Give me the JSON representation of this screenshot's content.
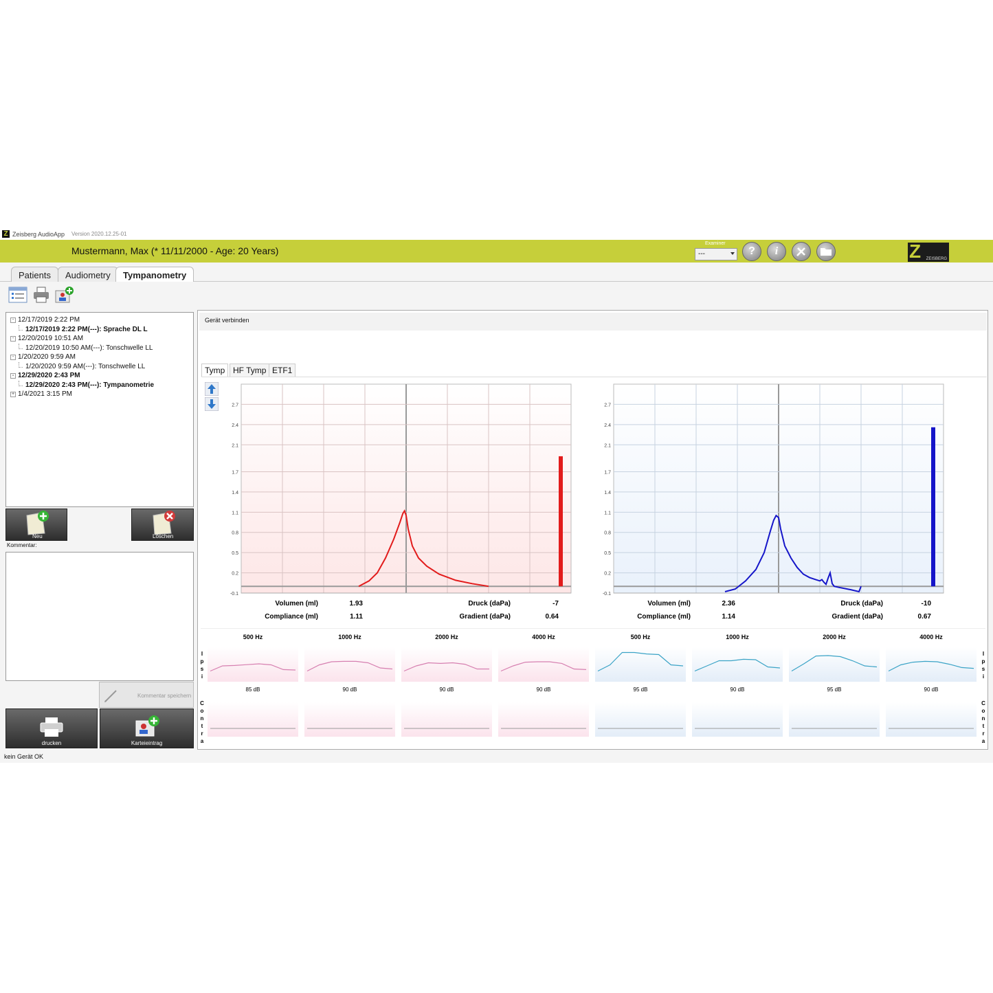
{
  "app": {
    "title": "Zeisberg AudioApp",
    "version": "Version 2020.12.25-01",
    "patient": "Mustermann, Max (* 11/11/2000 - Age: 20 Years)",
    "examiner_label": "Examiner",
    "examiner_value": "---",
    "brand": "ZEISBERG",
    "colors": {
      "accent": "#c6cf3a",
      "right_ear": "#e21b1b",
      "left_ear": "#1515c9"
    }
  },
  "tabs": [
    {
      "label": "Patients"
    },
    {
      "label": "Audiometry"
    },
    {
      "label": "Tympanometry"
    }
  ],
  "toolbar": {
    "icons": [
      "list-view-icon",
      "print-icon",
      "add-record-icon"
    ]
  },
  "tree": [
    {
      "label": "12/17/2019 2:22 PM",
      "expand": "-",
      "child": false,
      "bold": false
    },
    {
      "label": "12/17/2019 2:22 PM(---): Sprache DL L",
      "child": true,
      "bold": true
    },
    {
      "label": "12/20/2019 10:51 AM",
      "expand": "-",
      "child": false,
      "bold": false
    },
    {
      "label": "12/20/2019 10:50 AM(---): Tonschwelle LL",
      "child": true,
      "bold": false
    },
    {
      "label": "1/20/2020 9:59 AM",
      "expand": "-",
      "child": false,
      "bold": false
    },
    {
      "label": "1/20/2020 9:59 AM(---): Tonschwelle LL",
      "child": true,
      "bold": false
    },
    {
      "label": "12/29/2020 2:43 PM",
      "expand": "-",
      "child": false,
      "bold": true
    },
    {
      "label": "12/29/2020 2:43 PM(---): Tympanometrie",
      "child": true,
      "bold": true
    },
    {
      "label": "1/4/2021 3:15 PM",
      "expand": "+",
      "child": false,
      "bold": false
    }
  ],
  "buttons": {
    "new": "Neu",
    "delete": "Löschen",
    "comment_label": "Kommentar:",
    "save_comment": "Kommentar speichern",
    "print": "drucken",
    "record": "Karteieintrag"
  },
  "connect": "Gerät verbinden",
  "subtabs": [
    {
      "label": "Tymp"
    },
    {
      "label": "HF Tymp"
    },
    {
      "label": "ETF1"
    }
  ],
  "status": "kein Gerät  OK",
  "chart_data": [
    {
      "type": "line",
      "ear": "right",
      "color": "#e21b1b",
      "ylim": [
        -0.1,
        3.0
      ],
      "xlim": [
        -400,
        400
      ],
      "yticks": [
        "-0.1",
        "0.2",
        "0.5",
        "0.8",
        "1.1",
        "1.4",
        "1.7",
        "2.1",
        "2.4",
        "2.7"
      ],
      "x": [
        -115,
        -90,
        -70,
        -50,
        -30,
        -15,
        -8,
        -4,
        0,
        5,
        15,
        30,
        50,
        80,
        120,
        160,
        200
      ],
      "y": [
        0.0,
        0.08,
        0.2,
        0.42,
        0.7,
        0.95,
        1.08,
        1.12,
        1.05,
        0.85,
        0.6,
        0.42,
        0.3,
        0.18,
        0.09,
        0.04,
        0.0
      ],
      "volume_bar": 1.93,
      "stats": [
        {
          "label": "Volumen (ml)",
          "value": "1.93"
        },
        {
          "label": "Compliance (ml)",
          "value": "1.11"
        },
        {
          "label": "Druck (daPa)",
          "value": "-7"
        },
        {
          "label": "Gradient (daPa)",
          "value": "0.64"
        }
      ]
    },
    {
      "type": "line",
      "ear": "left",
      "color": "#1515c9",
      "ylim": [
        -0.1,
        3.0
      ],
      "xlim": [
        -400,
        400
      ],
      "yticks": [
        "-0.1",
        "0.2",
        "0.5",
        "0.8",
        "1.1",
        "1.4",
        "1.7",
        "2.1",
        "2.4",
        "2.7"
      ],
      "x": [
        -130,
        -105,
        -80,
        -55,
        -35,
        -20,
        -12,
        -6,
        0,
        5,
        15,
        30,
        45,
        60,
        75,
        90,
        100,
        105,
        110,
        115,
        120,
        125,
        130,
        135,
        150,
        175,
        195,
        200
      ],
      "y": [
        -0.08,
        -0.04,
        0.08,
        0.25,
        0.5,
        0.82,
        0.98,
        1.05,
        1.02,
        0.85,
        0.6,
        0.42,
        0.28,
        0.18,
        0.13,
        0.1,
        0.08,
        0.1,
        0.06,
        0.03,
        0.12,
        0.2,
        0.04,
        0.0,
        -0.02,
        -0.05,
        -0.08,
        0.0
      ],
      "volume_bar": 2.36,
      "stats": [
        {
          "label": "Volumen (ml)",
          "value": "2.36"
        },
        {
          "label": "Compliance (ml)",
          "value": "1.14"
        },
        {
          "label": "Druck (daPa)",
          "value": "-10"
        },
        {
          "label": "Gradient (daPa)",
          "value": "0.67"
        }
      ]
    }
  ],
  "reflex": {
    "ipsi_label": "Ipsi",
    "contra_label": "Contra",
    "panels": [
      {
        "freq": "500 Hz",
        "db": "85 dB",
        "ear": "right",
        "curve": [
          0.05,
          0.3,
          0.32,
          0.36,
          0.4,
          0.35,
          0.12,
          0.1
        ]
      },
      {
        "freq": "1000 Hz",
        "db": "90 dB",
        "ear": "right",
        "curve": [
          0.05,
          0.35,
          0.5,
          0.52,
          0.52,
          0.45,
          0.2,
          0.15
        ]
      },
      {
        "freq": "2000 Hz",
        "db": "90 dB",
        "ear": "right",
        "curve": [
          0.05,
          0.3,
          0.45,
          0.42,
          0.45,
          0.38,
          0.15,
          0.15
        ]
      },
      {
        "freq": "4000 Hz",
        "db": "90 dB",
        "ear": "right",
        "curve": [
          0.05,
          0.3,
          0.48,
          0.5,
          0.5,
          0.42,
          0.15,
          0.12
        ]
      },
      {
        "freq": "500 Hz",
        "db": "95 dB",
        "ear": "left",
        "curve": [
          0.05,
          0.35,
          0.95,
          0.95,
          0.88,
          0.85,
          0.35,
          0.3
        ]
      },
      {
        "freq": "1000 Hz",
        "db": "90 dB",
        "ear": "left",
        "curve": [
          0.05,
          0.3,
          0.55,
          0.55,
          0.62,
          0.6,
          0.25,
          0.2
        ]
      },
      {
        "freq": "2000 Hz",
        "db": "95 dB",
        "ear": "left",
        "curve": [
          0.05,
          0.4,
          0.78,
          0.8,
          0.75,
          0.55,
          0.3,
          0.25
        ]
      },
      {
        "freq": "4000 Hz",
        "db": "90 dB",
        "ear": "left",
        "curve": [
          0.05,
          0.35,
          0.48,
          0.52,
          0.5,
          0.38,
          0.22,
          0.18
        ]
      }
    ]
  }
}
